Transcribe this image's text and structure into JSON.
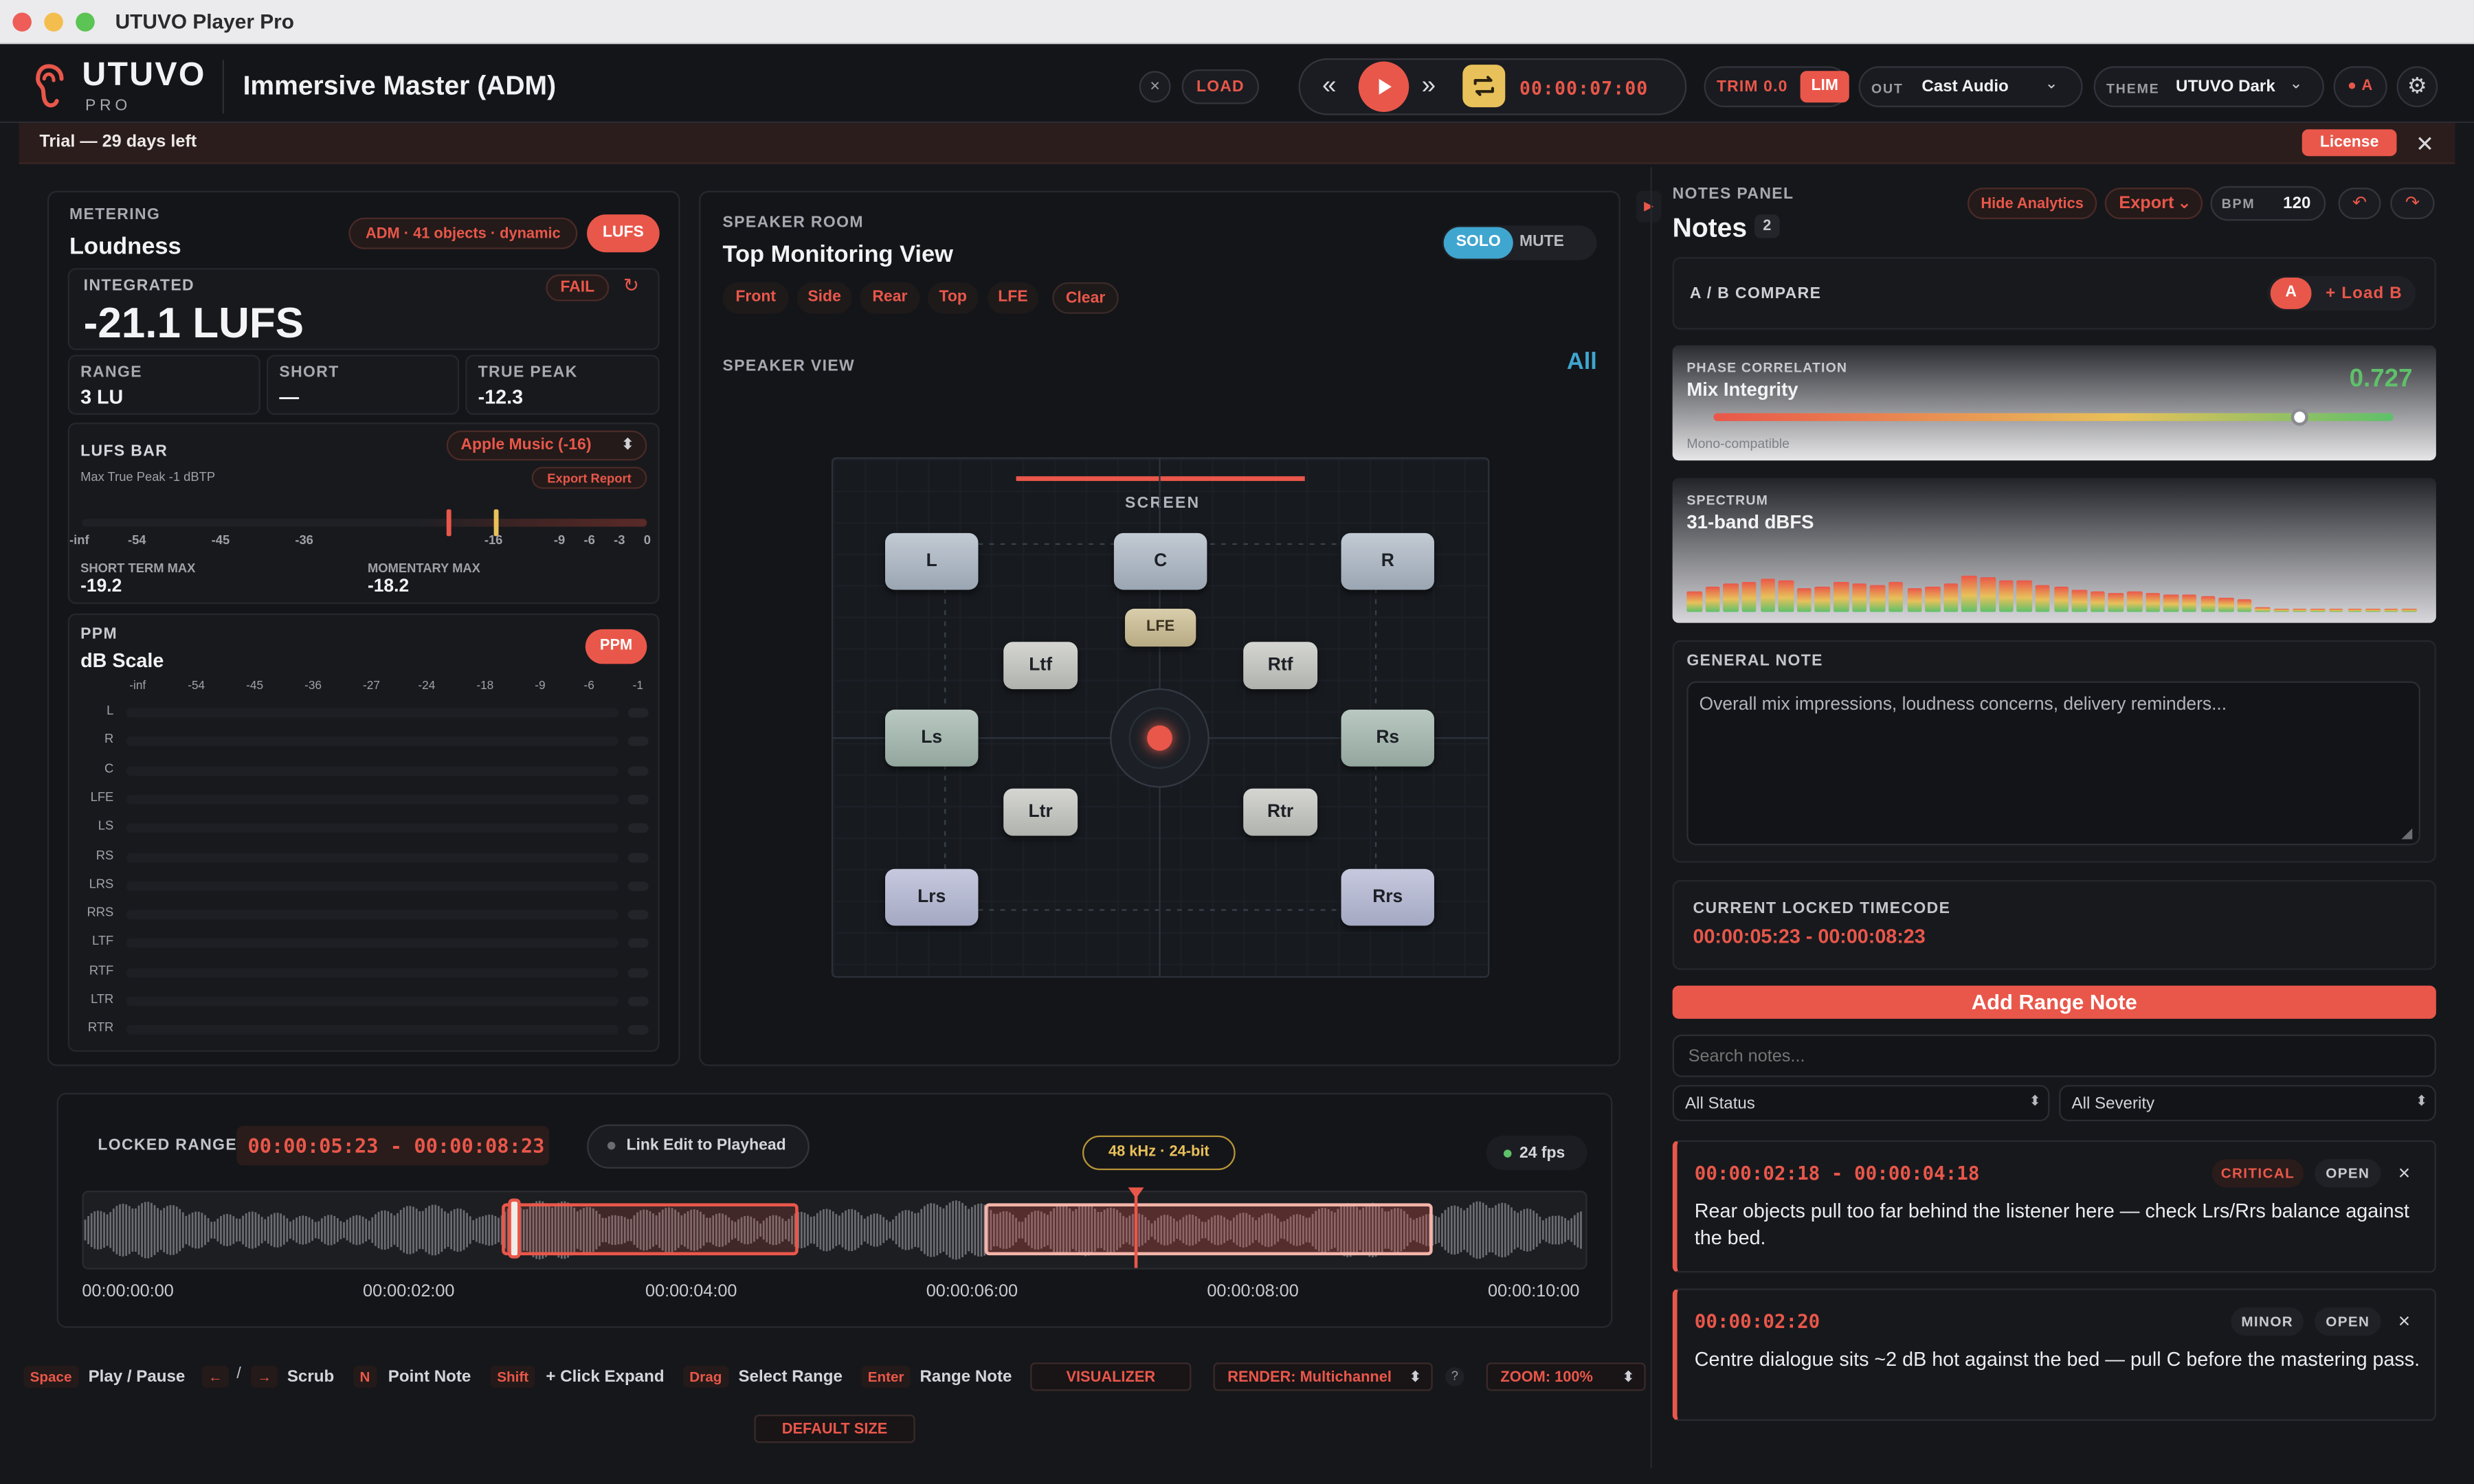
{
  "window": {
    "title": "UTUVO Player Pro"
  },
  "header": {
    "brand": "UTUVO",
    "brand_sub": "PRO",
    "project_title": "Immersive Master (ADM)",
    "close_symbol": "×",
    "load_label": "LOAD",
    "timecode": "00:00:07:00",
    "trim_label": "TRIM 0.0",
    "lim_label": "LIM",
    "out_label": "OUT",
    "out_value": "Cast Audio",
    "theme_label": "THEME",
    "theme_value": "UTUVO Dark",
    "record_badge": "● A"
  },
  "trial": {
    "text": "Trial — 29 days left",
    "license_label": "License",
    "close_symbol": "✕"
  },
  "metering": {
    "caption": "METERING",
    "title": "Loudness",
    "adm_badge": "ADM · 41 objects · dynamic",
    "lufs_button": "LUFS",
    "integrated_label": "INTEGRATED",
    "integrated_value": "-21.1 LUFS",
    "status": "FAIL",
    "range_label": "RANGE",
    "range_value": "3 LU",
    "short_label": "SHORT",
    "short_value": "—",
    "true_peak_label": "TRUE PEAK",
    "true_peak_value": "-12.3",
    "lufs_bar_label": "LUFS BAR",
    "lufs_bar_sub": "Max True Peak -1 dBTP",
    "target": "Apple Music (-16)",
    "export_label": "Export Report",
    "scale": [
      "-inf",
      "-54",
      "-45",
      "-36",
      "-16",
      "-9",
      "-6",
      "-3",
      "0"
    ],
    "short_term_max_label": "SHORT TERM MAX",
    "short_term_max_value": "-19.2",
    "momentary_max_label": "MOMENTARY MAX",
    "momentary_max_value": "-18.2",
    "ppm_caption": "PPM",
    "ppm_title": "dB Scale",
    "ppm_button": "PPM",
    "ppm_scale": [
      "-inf",
      "-54",
      "-45",
      "-36",
      "-27",
      "-24",
      "-18",
      "-9",
      "-6",
      "-1"
    ],
    "channels": [
      "L",
      "R",
      "C",
      "LFE",
      "LS",
      "RS",
      "LRS",
      "RRS",
      "LTF",
      "RTF",
      "LTR",
      "RTR"
    ]
  },
  "speaker_room": {
    "caption": "SPEAKER ROOM",
    "title": "Top Monitoring View",
    "solo_label": "SOLO",
    "mute_label": "MUTE",
    "filters": [
      "Front",
      "Side",
      "Rear",
      "Top",
      "LFE",
      "Clear"
    ],
    "view_label": "SPEAKER VIEW",
    "all_label": "All",
    "screen_label": "SCREEN",
    "speakers": {
      "l": "L",
      "c": "C",
      "r": "R",
      "lfe": "LFE",
      "ltf": "Ltf",
      "rtf": "Rtf",
      "ls": "Ls",
      "rs": "Rs",
      "ltr": "Ltr",
      "rtr": "Rtr",
      "lrs": "Lrs",
      "rrs": "Rrs"
    }
  },
  "timeline": {
    "locked_label": "LOCKED RANGE",
    "locked_value": "00:00:05:23 - 00:00:08:23",
    "link_label": "Link Edit to Playhead",
    "format": "48 kHz · 24-bit",
    "fps": "24 fps",
    "ticks": [
      "00:00:00:00",
      "00:00:02:00",
      "00:00:04:00",
      "00:00:06:00",
      "00:00:08:00",
      "00:00:10:00"
    ]
  },
  "shortcuts": [
    {
      "key": "Space",
      "label": "Play / Pause"
    },
    {
      "key": "←",
      "key2": "→",
      "label": "Scrub"
    },
    {
      "key": "N",
      "label": "Point Note"
    },
    {
      "key": "Shift",
      "label": "+ Click Expand"
    },
    {
      "key": "Drag",
      "label": "Select Range"
    },
    {
      "key": "Enter",
      "label": "Range Note"
    }
  ],
  "bottom_controls": {
    "visualizer": "VISUALIZER",
    "render": "RENDER: Multichannel",
    "help": "?",
    "zoom": "ZOOM: 100%",
    "default_size": "DEFAULT SIZE"
  },
  "notes": {
    "caption": "NOTES PANEL",
    "title": "Notes",
    "count": "2",
    "hide_analytics": "Hide Analytics",
    "export_label": "Export",
    "bpm_label": "BPM",
    "bpm_value": "120",
    "ab_label": "A / B COMPARE",
    "a_label": "A",
    "load_b": "+ Load B",
    "phase_caption": "PHASE CORRELATION",
    "phase_title": "Mix Integrity",
    "phase_value": "0.727",
    "phase_sub": "Mono-compatible",
    "phase_level": 0.727,
    "spectrum_caption": "SPECTRUM",
    "spectrum_title": "31-band dBFS",
    "spectrum_levels": [
      0.45,
      0.55,
      0.6,
      0.62,
      0.7,
      0.68,
      0.5,
      0.55,
      0.65,
      0.6,
      0.58,
      0.62,
      0.5,
      0.55,
      0.6,
      0.78,
      0.72,
      0.68,
      0.66,
      0.58,
      0.52,
      0.47,
      0.45,
      0.4,
      0.42,
      0.4,
      0.38,
      0.36,
      0.33,
      0.3,
      0.28,
      0.1,
      0.08,
      0.06,
      0.05,
      0.05,
      0.05,
      0.04,
      0.04,
      0.04
    ],
    "general_label": "GENERAL NOTE",
    "general_placeholder": "Overall mix impressions, loudness concerns, delivery reminders...",
    "current_label": "CURRENT LOCKED TIMECODE",
    "current_value": "00:00:05:23 - 00:00:08:23",
    "add_range": "Add Range Note",
    "search_placeholder": "Search notes...",
    "status_filter": "All Status",
    "severity_filter": "All Severity",
    "items": [
      {
        "tc": "00:00:02:18 - 00:00:04:18",
        "severity": "CRITICAL",
        "state": "OPEN",
        "close": "×",
        "text": "Rear objects pull too far behind the listener here — check Lrs/Rrs balance against the bed."
      },
      {
        "tc": "00:00:02:20",
        "severity": "MINOR",
        "state": "OPEN",
        "close": "×",
        "text": "Centre dialogue sits ~2 dB hot against the bed — pull C before the mastering pass."
      }
    ]
  },
  "colors": {
    "accent": "#e9574a",
    "solo": "#3fa6cf",
    "loop": "#e8c15a",
    "bg": "#16171b",
    "phase_good": "#5fc06a"
  }
}
